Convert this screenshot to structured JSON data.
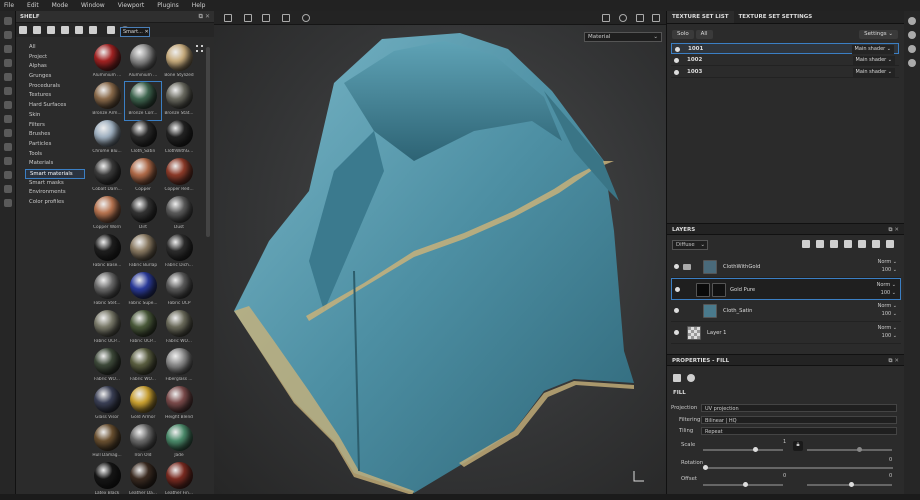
{
  "menu": [
    "File",
    "Edit",
    "Mode",
    "Window",
    "Viewport",
    "Plugins",
    "Help"
  ],
  "shelf": {
    "title": "SHELF",
    "search_text": "Smart...",
    "categories": [
      "All",
      "Project",
      "Alphas",
      "Grunges",
      "Procedurals",
      "Textures",
      "Hard Surfaces",
      "Skin",
      "Filters",
      "Brushes",
      "Particles",
      "Tools",
      "Materials",
      "Smart materials",
      "Smart masks",
      "Environments",
      "Color profiles"
    ],
    "materials": [
      {
        "label": "Aluminium ...",
        "color": "#a32222"
      },
      {
        "label": "Aluminium ...",
        "color": "#8b8b8b"
      },
      {
        "label": "Bone Stylized",
        "color": "#c7ab7c"
      },
      {
        "label": "Bronze Arm...",
        "color": "#8a6a4a"
      },
      {
        "label": "Bronze Corr...",
        "color": "#3f6650"
      },
      {
        "label": "Bronze Stat...",
        "color": "#6a6a60"
      },
      {
        "label": "Chrome Blu...",
        "color": "#9fb0c0"
      },
      {
        "label": "Cloth_Satin",
        "color": "#2a2a2a"
      },
      {
        "label": "ClothWithG...",
        "color": "#222"
      },
      {
        "label": "Cobalt Dam...",
        "color": "#3b3b3b"
      },
      {
        "label": "Copper",
        "color": "#b06a48"
      },
      {
        "label": "Copper Red...",
        "color": "#8c3a28"
      },
      {
        "label": "Copper Worn",
        "color": "#b87450"
      },
      {
        "label": "Dirt",
        "color": "#333"
      },
      {
        "label": "Dust",
        "color": "#5a5a5a"
      },
      {
        "label": "Fabric Base...",
        "color": "#1e1e1e"
      },
      {
        "label": "Fabric Burlap",
        "color": "#8a7a62"
      },
      {
        "label": "Fabric Dich...",
        "color": "#2c2c2c"
      },
      {
        "label": "Fabric Stet...",
        "color": "#6a6a6a"
      },
      {
        "label": "Fabric Supe...",
        "color": "#2a3a9a"
      },
      {
        "label": "Fabric UCP",
        "color": "#5a5a5a"
      },
      {
        "label": "Fabric UCP...",
        "color": "#7a7a6a"
      },
      {
        "label": "Fabric UCP...",
        "color": "#4a5a3a"
      },
      {
        "label": "Fabric WO...",
        "color": "#6a6a5a"
      },
      {
        "label": "Fabric WO...",
        "color": "#3e4a3a"
      },
      {
        "label": "Fabric WO...",
        "color": "#5a5e40"
      },
      {
        "label": "Fiberglass ...",
        "color": "#8a8a8a"
      },
      {
        "label": "Glass Visor",
        "color": "#3a3f55"
      },
      {
        "label": "Gold Armor",
        "color": "#c9a030"
      },
      {
        "label": "Height Blend",
        "color": "#7a4a4a"
      },
      {
        "label": "Hull Damag...",
        "color": "#6a5030"
      },
      {
        "label": "Iron Old",
        "color": "#6a6a6a"
      },
      {
        "label": "Jade",
        "color": "#4a8a6a"
      },
      {
        "label": "Latex Black",
        "color": "#151515"
      },
      {
        "label": "Leather Da...",
        "color": "#3a2a20"
      },
      {
        "label": "Leather Fin...",
        "color": "#7a2a20"
      }
    ]
  },
  "viewport": {
    "material_mode": "Material"
  },
  "texture_set": {
    "tab_list": "TEXTURE SET LIST",
    "tab_settings": "TEXTURE SET SETTINGS",
    "solo": "Solo",
    "all": "All",
    "settings": "Settings",
    "sets": [
      {
        "name": "1001",
        "shader": "Main shader"
      },
      {
        "name": "1002",
        "shader": "Main shader"
      },
      {
        "name": "1003",
        "shader": "Main shader"
      }
    ]
  },
  "layers": {
    "title": "LAYERS",
    "channel": "Diffuse",
    "items": [
      {
        "name": "ClothWithGold",
        "blend": "Norm",
        "opacity": "100"
      },
      {
        "name": "Gold Pure",
        "blend": "Norm",
        "opacity": "100"
      },
      {
        "name": "Cloth_Satin",
        "blend": "Norm",
        "opacity": "100"
      },
      {
        "name": "Layer 1",
        "blend": "Norm",
        "opacity": "100"
      }
    ]
  },
  "properties": {
    "title": "PROPERTIES - FILL",
    "section": "FILL",
    "projection_label": "Projection",
    "projection": "UV projection",
    "filtering_label": "Filtering",
    "filtering": "Bilinear | HQ",
    "tiling_label": "Tiling",
    "tiling": "Repeat",
    "scale_label": "Scale",
    "scale_value": "1",
    "rotation_label": "Rotation",
    "rotation_value": "0",
    "offset_label": "Offset",
    "offset_value_1": "0",
    "offset_value_2": "0"
  }
}
